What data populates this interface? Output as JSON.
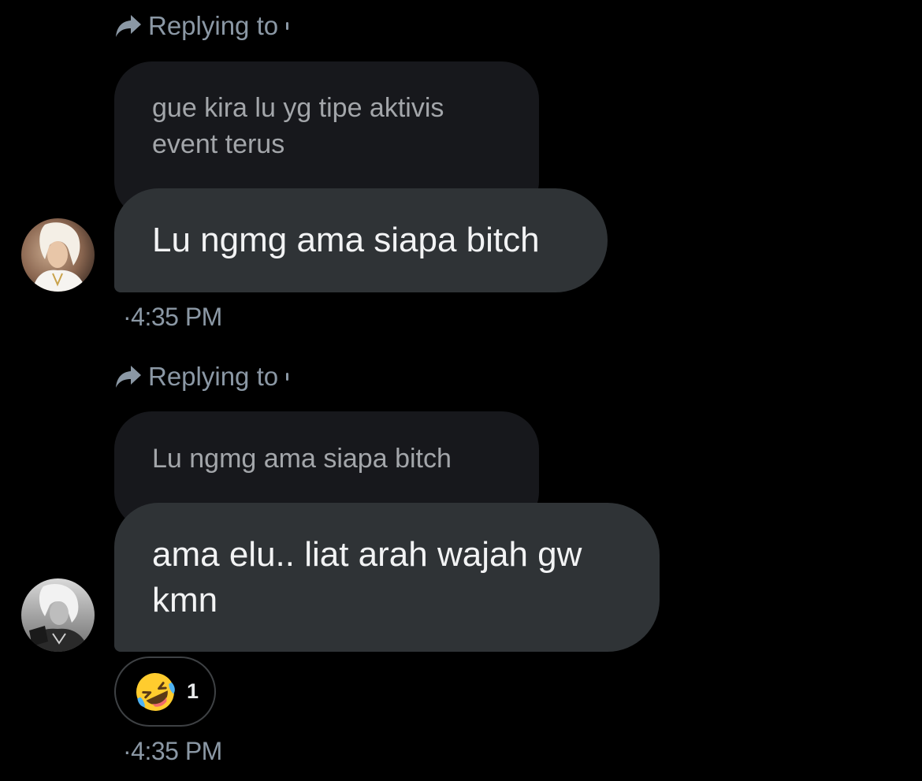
{
  "messages": [
    {
      "reply_label": "Replying to",
      "quoted_text": "gue kira lu yg tipe aktivis event terus",
      "text": "Lu ngmg ama siapa bitch",
      "timestamp": "4:35 PM",
      "avatar_icon": "user-avatar-photo"
    },
    {
      "reply_label": "Replying to",
      "quoted_text": "Lu ngmg ama siapa bitch",
      "text": "ama elu.. liat arah wajah gw kmn",
      "timestamp": "4:35 PM",
      "avatar_icon": "user-avatar-photo-bw",
      "reaction": {
        "emoji_icon": "rolling-on-floor-laughing-emoji",
        "count": "1"
      }
    }
  ],
  "timestamp_prefix": "·",
  "colors": {
    "background": "#000000",
    "bubble": "#2f3336",
    "quoted_bubble": "#17181c",
    "muted_text": "#8b98a5"
  }
}
